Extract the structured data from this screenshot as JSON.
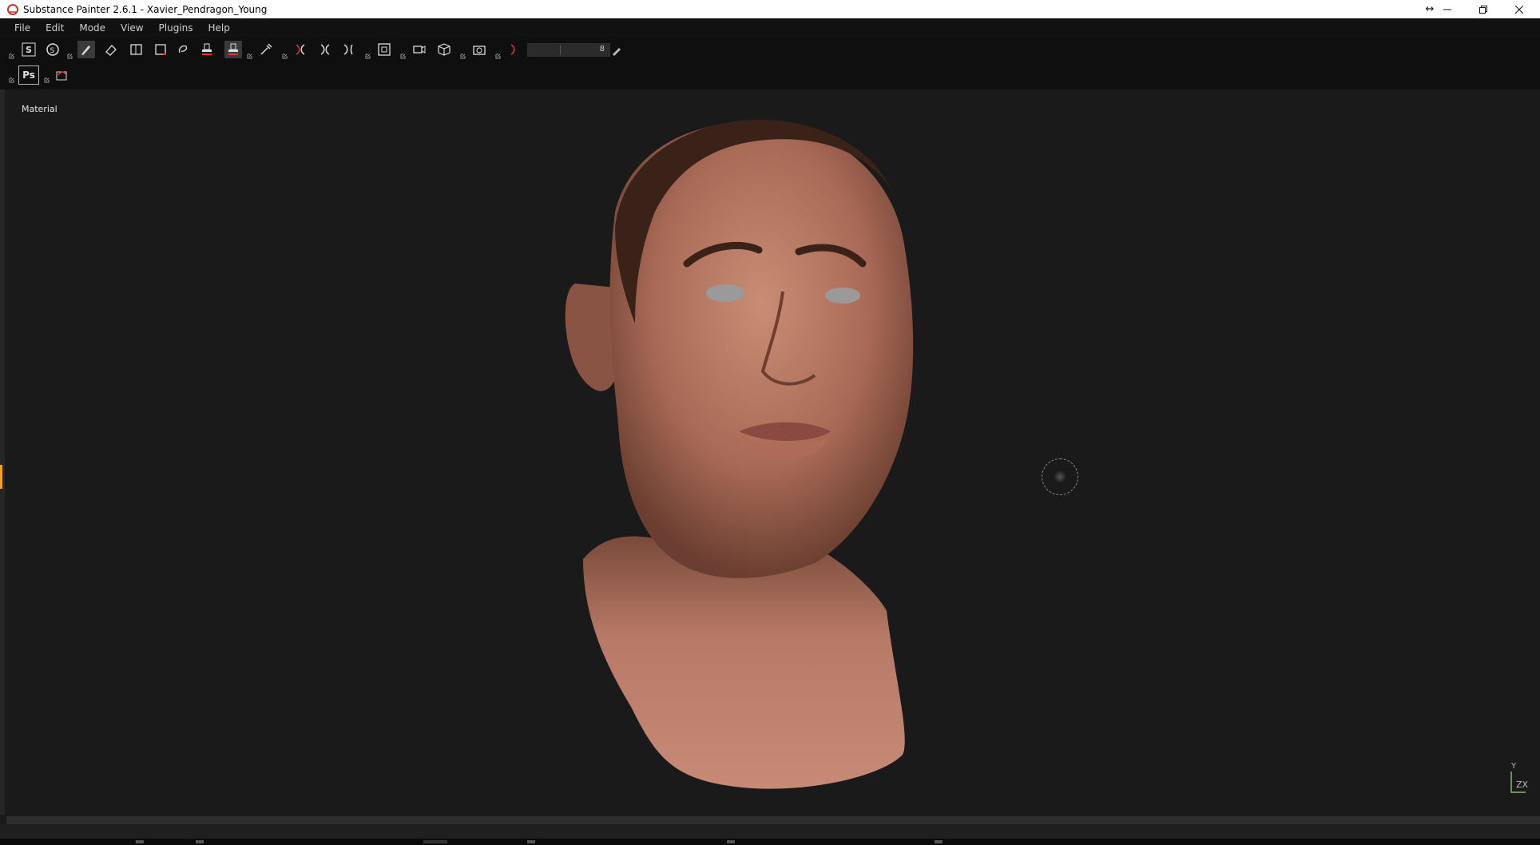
{
  "window": {
    "title": "Substance Painter 2.6.1 - Xavier_Pendragon_Young",
    "controls": [
      "resize-icon",
      "minimize-icon",
      "restore-icon",
      "close-icon"
    ]
  },
  "menu": {
    "items": [
      "File",
      "Edit",
      "Mode",
      "View",
      "Plugins",
      "Help"
    ]
  },
  "toolbar": {
    "row1_tools": [
      "substance-logo-icon",
      "substance-s-icon",
      "paint-brush-icon",
      "eraser-icon",
      "projection-icon",
      "polygon-fill-icon",
      "smudge-icon",
      "clone-stamp-icon",
      "material-picker-icon",
      "color-picker-icon",
      "symmetry-icon",
      "mirror-icon",
      "view-mode-icon",
      "camera-icon",
      "cube-icon",
      "screenshot-icon",
      "bake-icon"
    ],
    "row2_tools": [
      "photoshop-icon",
      "send-to-icon"
    ],
    "brush_size_value": "8",
    "photoshop_label": "Ps"
  },
  "viewport": {
    "material_label": "Material",
    "axis": {
      "y": "Y",
      "zx": "ZX"
    }
  }
}
